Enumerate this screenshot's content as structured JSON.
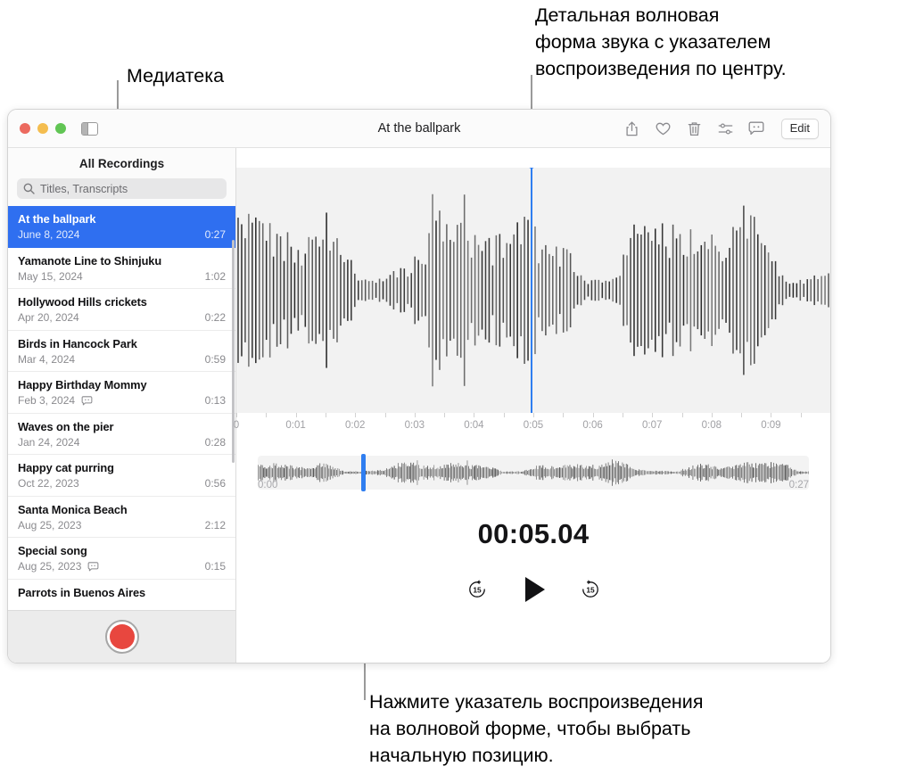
{
  "callouts": {
    "library": "Медиатека",
    "waveform": "Детальная волновая\nформа звука с указателем\nвоспроизведения по центру.",
    "playhead": "Нажмите указатель воспроизведения\nна волновой форме, чтобы выбрать\nначальную позицию."
  },
  "window": {
    "title": "At the ballpark",
    "toolbar": {
      "sidebar_toggle": "sidebar-toggle-icon",
      "share": "share-icon",
      "favorite": "heart-icon",
      "delete": "trash-icon",
      "enhance": "audio-settings-icon",
      "transcript": "transcript-icon",
      "edit_label": "Edit"
    }
  },
  "sidebar": {
    "header": "All Recordings",
    "search_placeholder": "Titles, Transcripts",
    "search_value": "",
    "record_button": "record-button",
    "recordings": [
      {
        "title": "At the ballpark",
        "date": "June 8, 2024",
        "duration": "0:27",
        "transcript": false,
        "selected": true
      },
      {
        "title": "Yamanote Line to Shinjuku",
        "date": "May 15, 2024",
        "duration": "1:02",
        "transcript": false,
        "selected": false
      },
      {
        "title": "Hollywood Hills crickets",
        "date": "Apr 20, 2024",
        "duration": "0:22",
        "transcript": false,
        "selected": false
      },
      {
        "title": "Birds in Hancock Park",
        "date": "Mar 4, 2024",
        "duration": "0:59",
        "transcript": false,
        "selected": false
      },
      {
        "title": "Happy Birthday Mommy",
        "date": "Feb 3, 2024",
        "duration": "0:13",
        "transcript": true,
        "selected": false
      },
      {
        "title": "Waves on the pier",
        "date": "Jan 24, 2024",
        "duration": "0:28",
        "transcript": false,
        "selected": false
      },
      {
        "title": "Happy cat purring",
        "date": "Oct 22, 2023",
        "duration": "0:56",
        "transcript": false,
        "selected": false
      },
      {
        "title": "Santa Monica Beach",
        "date": "Aug 25, 2023",
        "duration": "2:12",
        "transcript": false,
        "selected": false
      },
      {
        "title": "Special song",
        "date": "Aug 25, 2023",
        "duration": "0:15",
        "transcript": true,
        "selected": false
      },
      {
        "title": "Parrots in Buenos Aires",
        "date": "",
        "duration": "",
        "transcript": false,
        "selected": false
      }
    ]
  },
  "detail": {
    "ruler_labels": [
      "0:01",
      "0:02",
      "0:03",
      "0:04",
      "0:05",
      "0:06",
      "0:07",
      "0:08",
      "0:09"
    ],
    "playhead_percent": 49.6,
    "overview": {
      "start_label": "0:00",
      "end_label": "0:27",
      "playhead_percent": 18.8
    },
    "time_display": "00:05.04",
    "controls": {
      "skip_back": "15",
      "play": "play-icon",
      "skip_forward": "15"
    }
  },
  "colors": {
    "accent": "#2f6ff0",
    "playhead": "#2f7ef0",
    "record": "#e8473f",
    "panel_bg": "#f2f2f2"
  }
}
